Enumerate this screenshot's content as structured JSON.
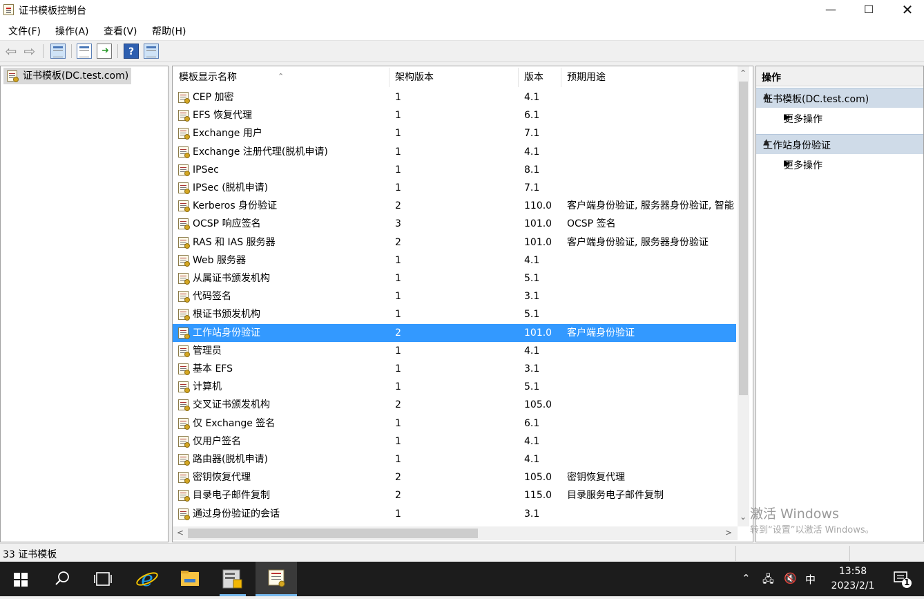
{
  "window": {
    "title": "证书模板控制台"
  },
  "menu": [
    "文件(F)",
    "操作(A)",
    "查看(V)",
    "帮助(H)"
  ],
  "tree": {
    "root": "证书模板(DC.test.com)"
  },
  "list": {
    "columns": [
      "模板显示名称",
      "架构版本",
      "版本",
      "预期用途"
    ],
    "rows": [
      {
        "name": "CEP 加密",
        "schema": "1",
        "version": "4.1",
        "purpose": ""
      },
      {
        "name": "EFS 恢复代理",
        "schema": "1",
        "version": "6.1",
        "purpose": ""
      },
      {
        "name": "Exchange 用户",
        "schema": "1",
        "version": "7.1",
        "purpose": ""
      },
      {
        "name": "Exchange 注册代理(脱机申请)",
        "schema": "1",
        "version": "4.1",
        "purpose": ""
      },
      {
        "name": "IPSec",
        "schema": "1",
        "version": "8.1",
        "purpose": ""
      },
      {
        "name": "IPSec (脱机申请)",
        "schema": "1",
        "version": "7.1",
        "purpose": ""
      },
      {
        "name": "Kerberos 身份验证",
        "schema": "2",
        "version": "110.0",
        "purpose": "客户端身份验证, 服务器身份验证, 智能"
      },
      {
        "name": "OCSP 响应签名",
        "schema": "3",
        "version": "101.0",
        "purpose": "OCSP 签名"
      },
      {
        "name": "RAS 和 IAS 服务器",
        "schema": "2",
        "version": "101.0",
        "purpose": "客户端身份验证, 服务器身份验证"
      },
      {
        "name": "Web 服务器",
        "schema": "1",
        "version": "4.1",
        "purpose": ""
      },
      {
        "name": "从属证书颁发机构",
        "schema": "1",
        "version": "5.1",
        "purpose": ""
      },
      {
        "name": "代码签名",
        "schema": "1",
        "version": "3.1",
        "purpose": ""
      },
      {
        "name": "根证书颁发机构",
        "schema": "1",
        "version": "5.1",
        "purpose": ""
      },
      {
        "name": "工作站身份验证",
        "schema": "2",
        "version": "101.0",
        "purpose": "客户端身份验证",
        "selected": true
      },
      {
        "name": "管理员",
        "schema": "1",
        "version": "4.1",
        "purpose": ""
      },
      {
        "name": "基本 EFS",
        "schema": "1",
        "version": "3.1",
        "purpose": ""
      },
      {
        "name": "计算机",
        "schema": "1",
        "version": "5.1",
        "purpose": ""
      },
      {
        "name": "交叉证书颁发机构",
        "schema": "2",
        "version": "105.0",
        "purpose": ""
      },
      {
        "name": "仅 Exchange 签名",
        "schema": "1",
        "version": "6.1",
        "purpose": ""
      },
      {
        "name": "仅用户签名",
        "schema": "1",
        "version": "4.1",
        "purpose": ""
      },
      {
        "name": "路由器(脱机申请)",
        "schema": "1",
        "version": "4.1",
        "purpose": ""
      },
      {
        "name": "密钥恢复代理",
        "schema": "2",
        "version": "105.0",
        "purpose": "密钥恢复代理"
      },
      {
        "name": "目录电子邮件复制",
        "schema": "2",
        "version": "115.0",
        "purpose": "目录服务电子邮件复制"
      },
      {
        "name": "通过身份验证的会话",
        "schema": "1",
        "version": "3.1",
        "purpose": ""
      }
    ]
  },
  "actions": {
    "header": "操作",
    "groups": [
      {
        "title": "证书模板(DC.test.com)",
        "item": "更多操作"
      },
      {
        "title": "工作站身份验证",
        "item": "更多操作"
      }
    ]
  },
  "status": {
    "text": "33 证书模板"
  },
  "watermark": {
    "line1": "激活 Windows",
    "line2": "转到“设置”以激活 Windows。"
  },
  "taskbar": {
    "ime": "中",
    "time": "13:58",
    "date": "2023/2/1",
    "notifications": "1"
  },
  "colors": {
    "selection": "#3399ff",
    "action_group": "#cfdbe8",
    "taskbar": "#1c1c1c"
  }
}
